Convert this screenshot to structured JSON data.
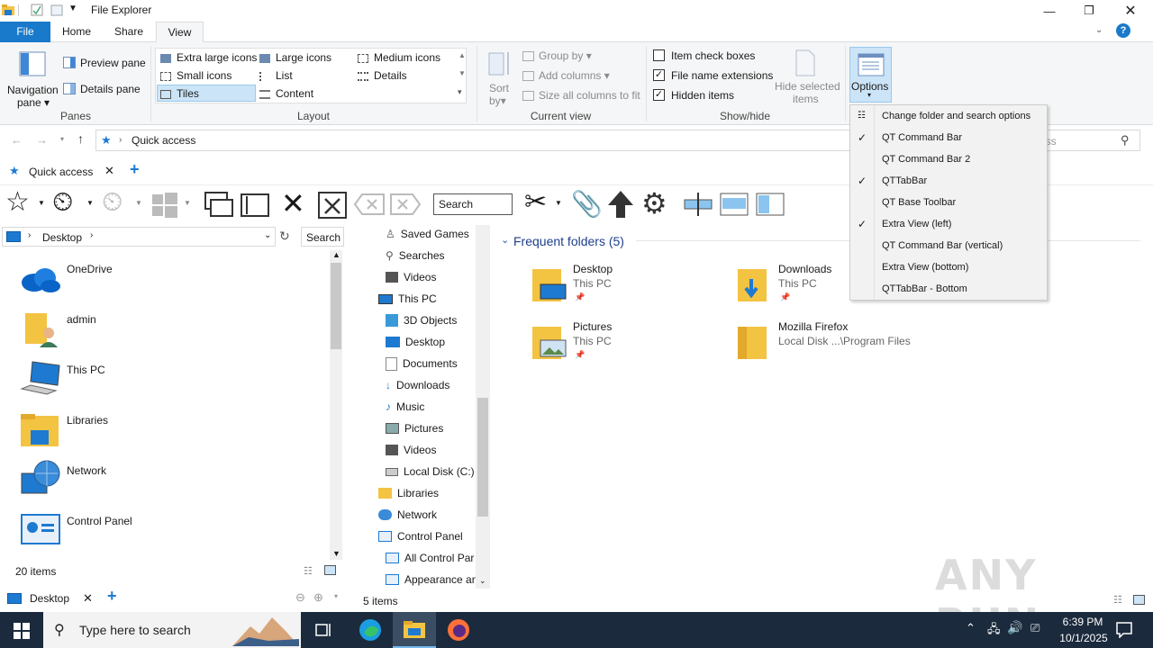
{
  "window": {
    "title": "File Explorer"
  },
  "ribbon_tabs": [
    "File",
    "Home",
    "Share",
    "View"
  ],
  "panes_group": {
    "nav_pane": "Navigation",
    "nav_pane2": "pane",
    "preview": "Preview pane",
    "details": "Details pane",
    "label": "Panes"
  },
  "layout_group": {
    "items": [
      "Extra large icons",
      "Large icons",
      "Medium icons",
      "Small icons",
      "List",
      "Details",
      "Tiles",
      "Content"
    ],
    "label": "Layout"
  },
  "current_view_group": {
    "sort": "Sort",
    "sort2": "by",
    "group_by": "Group by",
    "add_columns": "Add columns",
    "size_cols": "Size all columns to fit",
    "label": "Current view"
  },
  "showhide_group": {
    "item_checks": "Item check boxes",
    "ext": "File name extensions",
    "hidden": "Hidden items",
    "hide_sel": "Hide selected",
    "hide_sel2": "items",
    "label": "Show/hide"
  },
  "options": {
    "label": "Options"
  },
  "address": {
    "location": "Quick access",
    "search_placeholder": "ess"
  },
  "qt_tab": {
    "label": "Quick access"
  },
  "cmd_search": "Search",
  "left_pane": {
    "path": "Desktop",
    "search": "Search I",
    "items": [
      "OneDrive",
      "admin",
      "This PC",
      "Libraries",
      "Network",
      "Control Panel"
    ],
    "count": "20 items",
    "bottom_tab": "Desktop"
  },
  "tree": [
    "Saved Games",
    "Searches",
    "Videos",
    "This PC",
    "3D Objects",
    "Desktop",
    "Documents",
    "Downloads",
    "Music",
    "Pictures",
    "Videos",
    "Local Disk (C:)",
    "Libraries",
    "Network",
    "Control Panel",
    "All Control Par",
    "Appearance an"
  ],
  "content": {
    "header": "Frequent folders (5)",
    "folders": [
      {
        "name": "Desktop",
        "sub": "This PC"
      },
      {
        "name": "Downloads",
        "sub": "This PC"
      },
      {
        "name": "Pictures",
        "sub": "This PC"
      },
      {
        "name": "Mozilla Firefox",
        "sub": "Local Disk ...\\Program Files"
      }
    ],
    "status": "5 items"
  },
  "dropdown": {
    "items": [
      {
        "label": "Change folder and search options",
        "checked": false
      },
      {
        "label": "QT Command Bar",
        "checked": true
      },
      {
        "label": "QT Command Bar 2",
        "checked": false
      },
      {
        "label": "QTTabBar",
        "checked": true
      },
      {
        "label": "QT Base Toolbar",
        "checked": false
      },
      {
        "label": "Extra View (left)",
        "checked": true
      },
      {
        "label": "QT Command Bar (vertical)",
        "checked": false
      },
      {
        "label": "Extra View (bottom)",
        "checked": false
      },
      {
        "label": "QTTabBar - Bottom",
        "checked": false
      }
    ]
  },
  "taskbar": {
    "search": "Type here to search",
    "time": "6:39 PM",
    "date": "10/1/2025"
  },
  "watermark": "ANY RUN"
}
